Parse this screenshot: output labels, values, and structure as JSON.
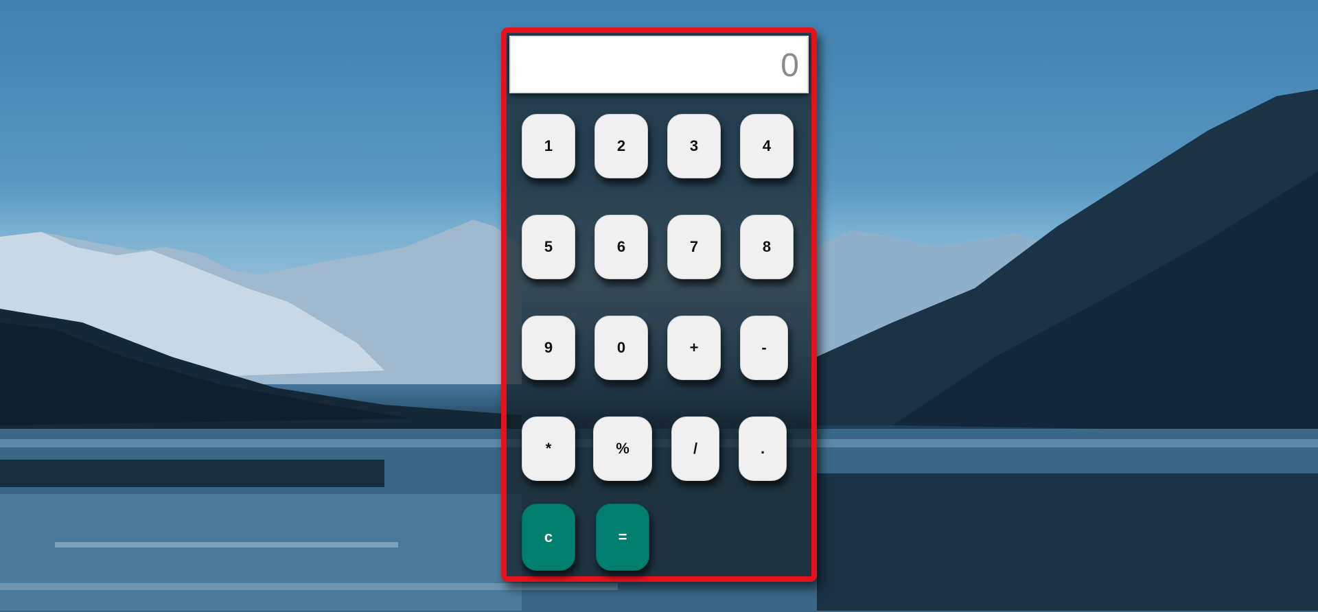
{
  "calculator": {
    "display_value": "0",
    "buttons": [
      {
        "label": "1"
      },
      {
        "label": "2"
      },
      {
        "label": "3"
      },
      {
        "label": "4"
      },
      {
        "label": "5"
      },
      {
        "label": "6"
      },
      {
        "label": "7"
      },
      {
        "label": "8"
      },
      {
        "label": "9"
      },
      {
        "label": "0"
      },
      {
        "label": "+"
      },
      {
        "label": "-"
      },
      {
        "label": "*"
      },
      {
        "label": "%"
      },
      {
        "label": "/"
      },
      {
        "label": "."
      },
      {
        "label": "c"
      },
      {
        "label": "="
      }
    ]
  },
  "colors": {
    "frame": "#e6121b",
    "key": "#f0f0f0",
    "func_key": "#007e6f"
  }
}
